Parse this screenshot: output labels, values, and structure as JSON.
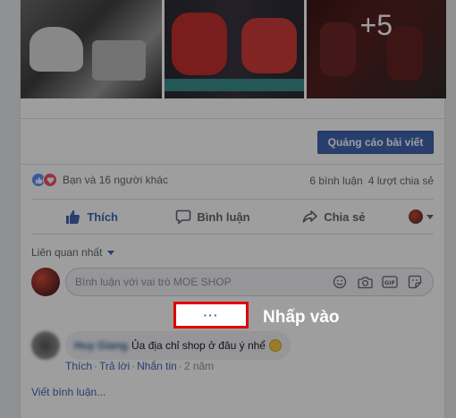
{
  "photos": {
    "more_count": "+5"
  },
  "post": {
    "boost_label": "Quảng cáo bài viết",
    "reactions_text": "Bạn và 16 người khác",
    "comments_count": "6 bình luận",
    "shares_count": "4 lượt chia sẻ",
    "actions": {
      "like": "Thích",
      "comment": "Bình luận",
      "share": "Chia sẻ"
    }
  },
  "comments": {
    "sort_label": "Liên quan nhất",
    "input_placeholder": "Bình luận với vai trò MOE SHOP",
    "more_button": "···",
    "items": [
      {
        "author": "Huy Giang",
        "text": "Ủa địa chỉ shop ở đâu ý nhể",
        "actions": [
          "Thích",
          "Trả lời",
          "Nhắn tin"
        ],
        "time": "2 năm"
      }
    ],
    "write_comment": "Viết bình luận..."
  },
  "annotation": {
    "callout": "Nhấp vào"
  },
  "colors": {
    "accent": "#4267b2",
    "highlight_border": "#e00000",
    "background": "#e9ebee"
  }
}
